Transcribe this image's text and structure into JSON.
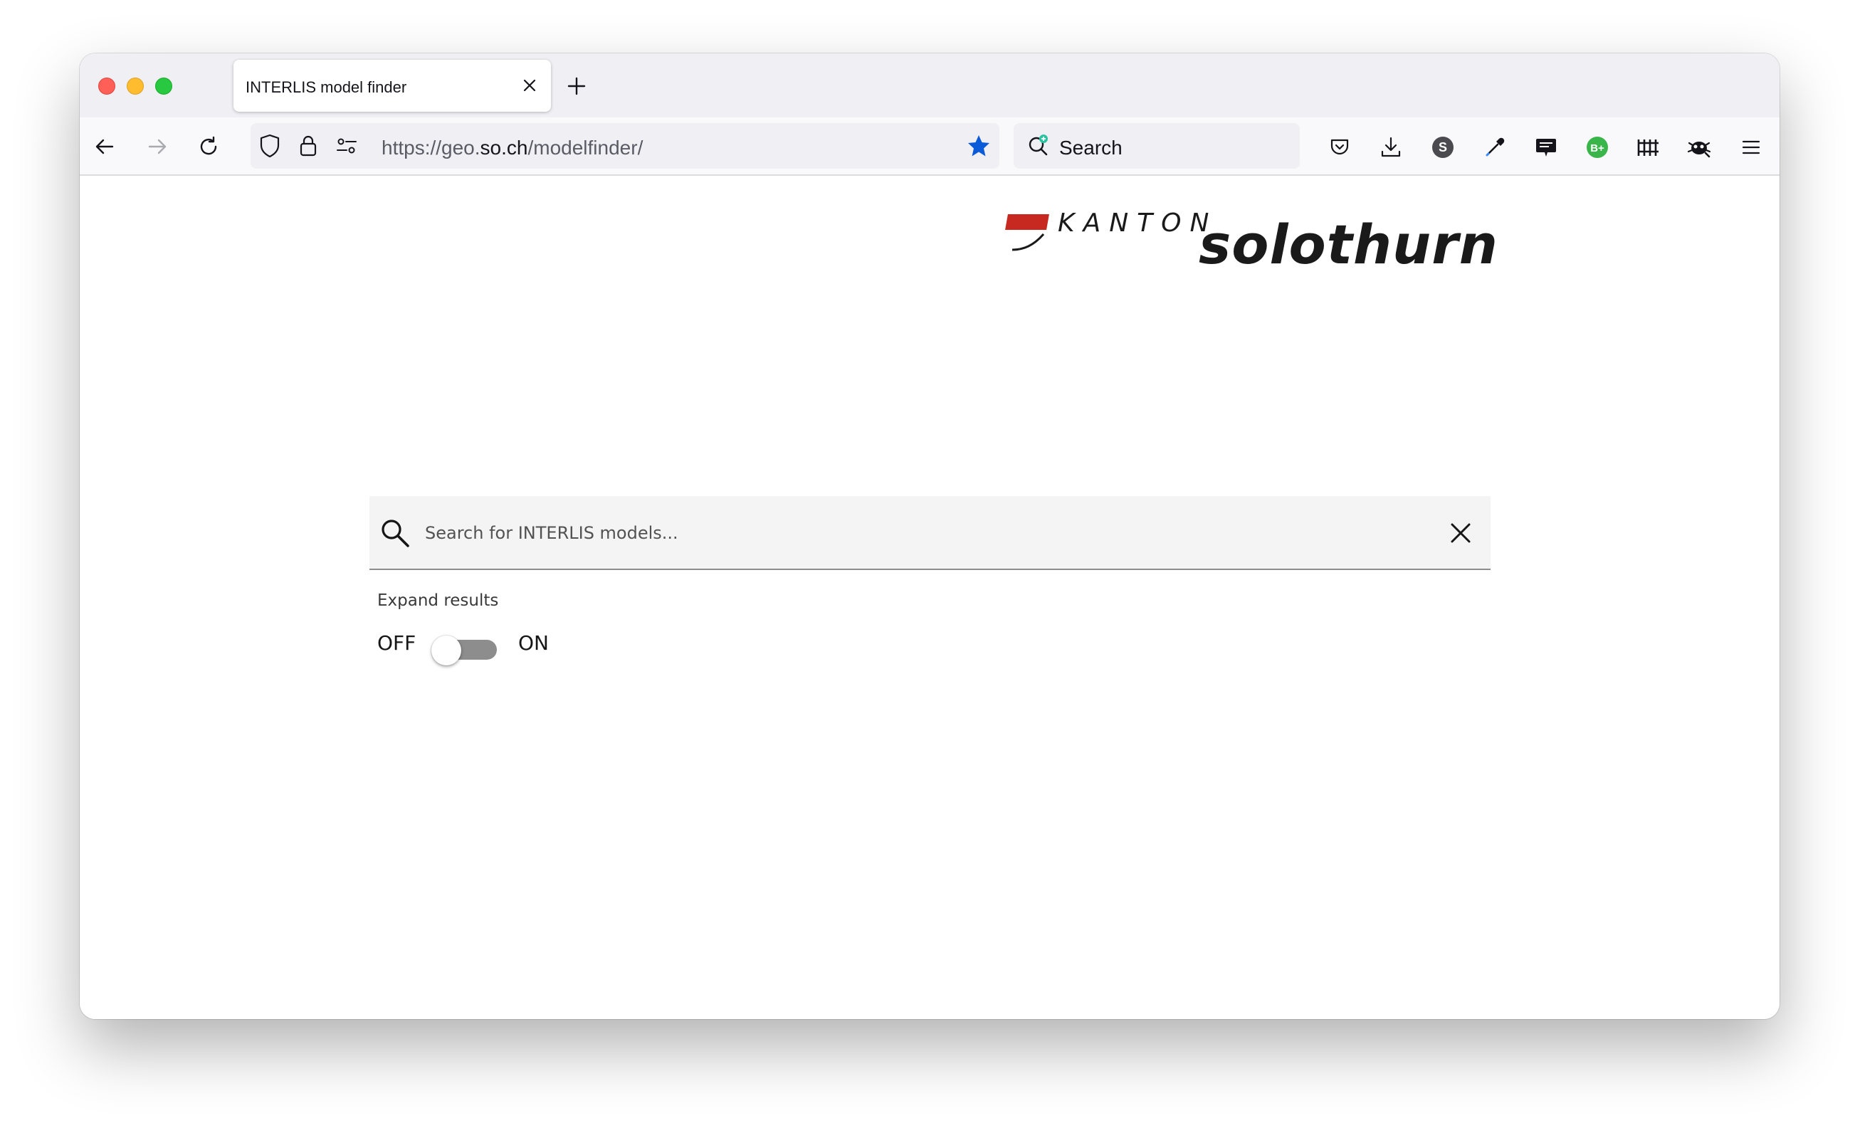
{
  "browser": {
    "tab_title": "INTERLIS model finder",
    "url_prefix": "https://geo.",
    "url_domain": "so.ch",
    "url_path": "/modelfinder/",
    "search_label": "Search",
    "ext_s_label": "S",
    "ext_b_label": "B+"
  },
  "logo": {
    "kanton": "KANTON",
    "name": "solothurn",
    "flag_color": "#c7281f"
  },
  "search": {
    "placeholder": "Search for INTERLIS models...",
    "value": ""
  },
  "expand": {
    "label": "Expand results",
    "off_label": "OFF",
    "on_label": "ON",
    "state": "off"
  }
}
